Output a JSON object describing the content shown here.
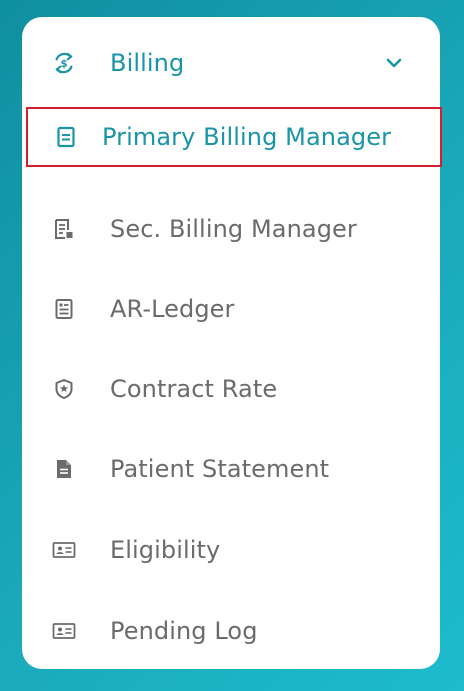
{
  "menu": {
    "header": {
      "label": "Billing",
      "icon": "dollar-refresh-icon",
      "chevron": "chevron-down-icon"
    },
    "items": [
      {
        "label": "Primary Billing Manager",
        "icon": "document-icon",
        "selected": true
      },
      {
        "label": "Sec. Billing Manager",
        "icon": "receipt-icon",
        "selected": false
      },
      {
        "label": "AR-Ledger",
        "icon": "ledger-icon",
        "selected": false
      },
      {
        "label": "Contract Rate",
        "icon": "shield-star-icon",
        "selected": false
      },
      {
        "label": "Patient Statement",
        "icon": "file-text-icon",
        "selected": false
      },
      {
        "label": "Eligibility",
        "icon": "id-card-icon",
        "selected": false
      },
      {
        "label": "Pending Log",
        "icon": "id-card-icon",
        "selected": false
      }
    ]
  },
  "colors": {
    "accent": "#1a95a8",
    "text": "#6b6b6b",
    "selection_outline": "#d4202c",
    "background": "#1aa9bb"
  }
}
